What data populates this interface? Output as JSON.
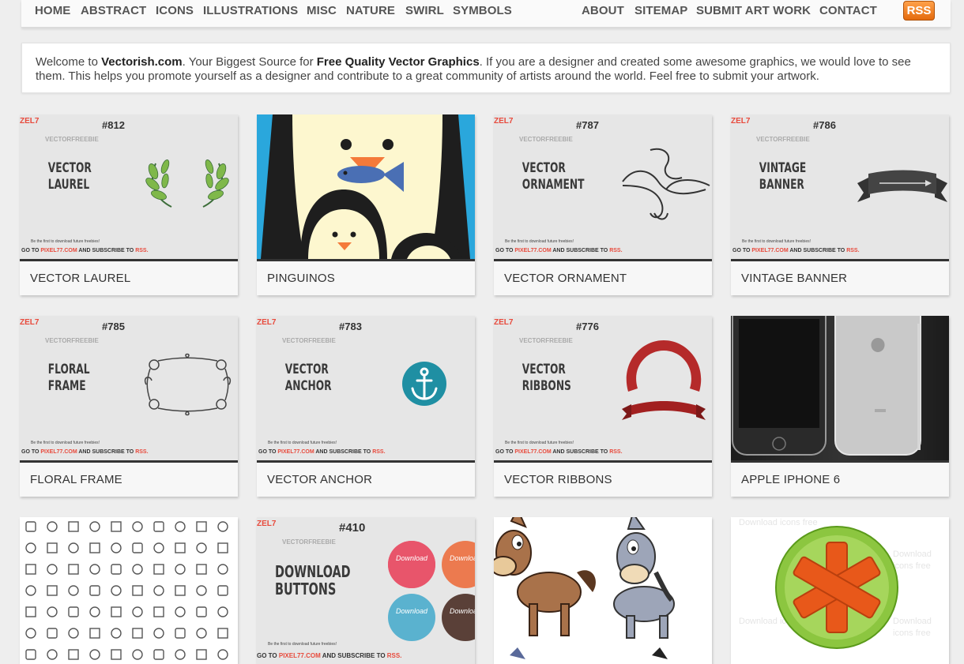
{
  "nav": {
    "left": [
      "HOME",
      "ABSTRACT",
      "ICONS",
      "ILLUSTRATIONS",
      "MISC",
      "NATURE",
      "SWIRL",
      "SYMBOLS"
    ],
    "right": [
      "ABOUT",
      "SITEMAP",
      "SUBMIT ART WORK",
      "CONTACT"
    ],
    "rss": "RSS"
  },
  "welcome": {
    "t1": "Welcome to ",
    "site": "Vectorish.com",
    "t2": ". Your Biggest Source for ",
    "strong": "Free Quality Vector Graphics",
    "t3": ". If you are a designer and created some awesome graphics, we would love to see them. This helps you promote yourself as a designer and contribute to a great community of artists around the world. Feel free to submit your artwork."
  },
  "freebie": {
    "logo_a": "ZEL",
    "logo_b": "7",
    "vf": "VECTORFREEBIE",
    "be_first": "Be the first to download future freebies!",
    "goto_a": "GO TO ",
    "goto_b": "PIXEL77.COM",
    "goto_c": " AND SUBSCRIBE TO ",
    "goto_d": "RSS."
  },
  "cards": [
    {
      "title": "VECTOR LAUREL",
      "num": "#812",
      "big1": "VECTOR",
      "big2": "LAUREL"
    },
    {
      "title": "PINGUINOS"
    },
    {
      "title": "VECTOR ORNAMENT",
      "num": "#787",
      "big1": "VECTOR",
      "big2": "ORNAMENT"
    },
    {
      "title": "VINTAGE BANNER",
      "num": "#786",
      "big1": "VINTAGE",
      "big2": "BANNER"
    },
    {
      "title": "FLORAL FRAME",
      "num": "#785",
      "big1": "FLORAL",
      "big2": "FRAME"
    },
    {
      "title": "VECTOR ANCHOR",
      "num": "#783",
      "big1": "VECTOR",
      "big2": "ANCHOR"
    },
    {
      "title": "VECTOR RIBBONS",
      "num": "#776",
      "big1": "VECTOR",
      "big2": "RIBBONS"
    },
    {
      "title": "APPLE IPHONE 6"
    },
    {
      "title": ""
    },
    {
      "title": "",
      "num": "#410",
      "big1": "DOWNLOAD",
      "big2": "BUTTONS",
      "btn": "Download"
    },
    {
      "title": ""
    },
    {
      "title": "",
      "wm": "Download icons free"
    }
  ]
}
